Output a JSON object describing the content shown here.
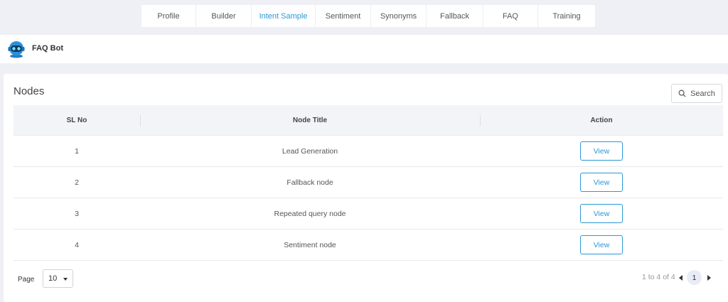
{
  "tabs": [
    {
      "label": "Profile"
    },
    {
      "label": "Builder"
    },
    {
      "label": "Intent Sample"
    },
    {
      "label": "Sentiment"
    },
    {
      "label": "Synonyms"
    },
    {
      "label": "Fallback"
    },
    {
      "label": "FAQ"
    },
    {
      "label": "Training"
    }
  ],
  "active_tab": "Intent Sample",
  "bot": {
    "name": "FAQ Bot",
    "avatar_icon": "robot-head-icon"
  },
  "card": {
    "title": "Nodes",
    "search_label": "Search",
    "search_icon": "search-icon"
  },
  "table": {
    "headers": [
      "SL No",
      "Node Title",
      "Action"
    ],
    "rows": [
      {
        "sl": "1",
        "title": "Lead Generation",
        "action": "View"
      },
      {
        "sl": "2",
        "title": "Fallback node",
        "action": "View"
      },
      {
        "sl": "3",
        "title": "Repeated query node",
        "action": "View"
      },
      {
        "sl": "4",
        "title": "Sentiment node",
        "action": "View"
      }
    ]
  },
  "footer": {
    "page_label": "Page",
    "page_size": "10",
    "range_text": "1 to 4 of 4",
    "current_page": "1"
  },
  "colors": {
    "accent": "#2a98d6",
    "background": "#eef0f5",
    "header_row": "#f3f4f8"
  }
}
